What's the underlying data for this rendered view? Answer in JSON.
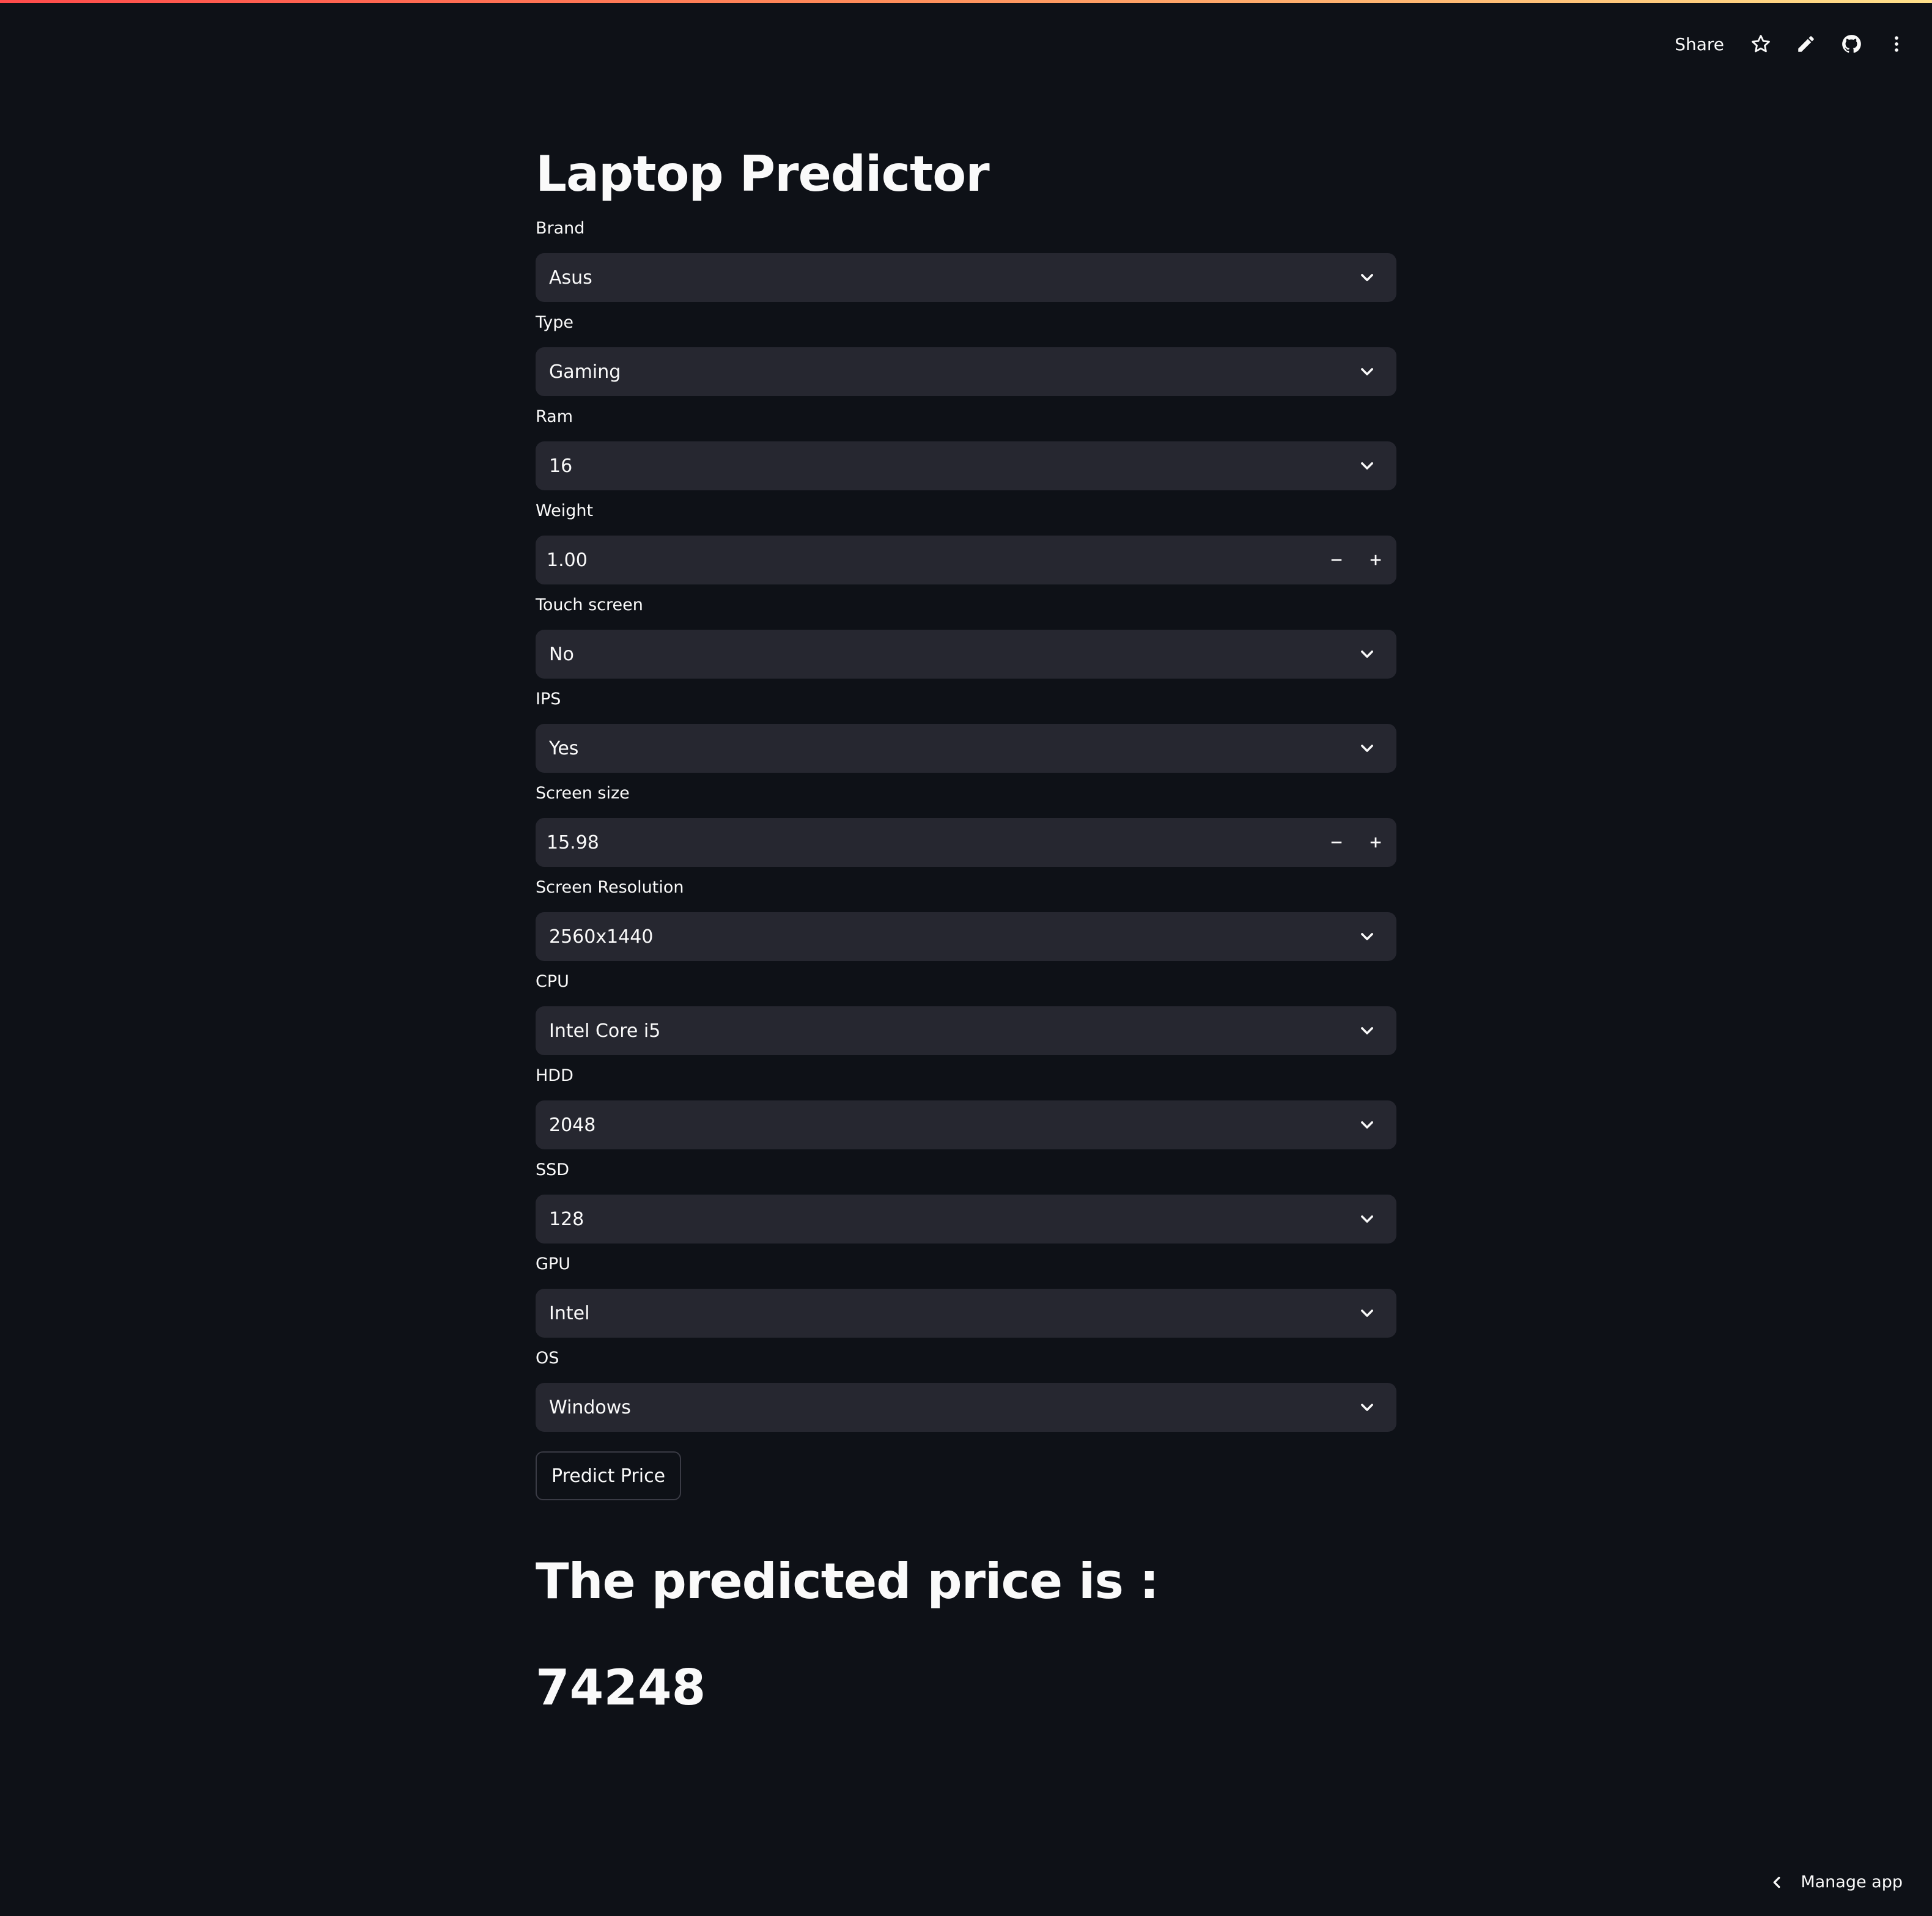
{
  "header": {
    "share_label": "Share",
    "icons": [
      "star-icon",
      "pencil-icon",
      "github-icon",
      "more-vertical-icon"
    ]
  },
  "page": {
    "title": "Laptop Predictor"
  },
  "fields": {
    "brand": {
      "label": "Brand",
      "value": "Asus"
    },
    "type": {
      "label": "Type",
      "value": "Gaming"
    },
    "ram": {
      "label": "Ram",
      "value": "16"
    },
    "weight": {
      "label": "Weight",
      "value": "1.00"
    },
    "touch_screen": {
      "label": "Touch screen",
      "value": "No"
    },
    "ips": {
      "label": "IPS",
      "value": "Yes"
    },
    "screen_size": {
      "label": "Screen size",
      "value": "15.98"
    },
    "screen_resolution": {
      "label": "Screen Resolution",
      "value": "2560x1440"
    },
    "cpu": {
      "label": "CPU",
      "value": "Intel Core i5"
    },
    "hdd": {
      "label": "HDD",
      "value": "2048"
    },
    "ssd": {
      "label": "SSD",
      "value": "128"
    },
    "gpu": {
      "label": "GPU",
      "value": "Intel"
    },
    "os": {
      "label": "OS",
      "value": "Windows"
    }
  },
  "actions": {
    "predict_label": "Predict Price"
  },
  "result": {
    "heading": "The predicted price is :",
    "value": "74248"
  },
  "footer": {
    "manage_label": "Manage app"
  },
  "colors": {
    "background": "#0e1117",
    "input_bg": "#262730",
    "text": "#fafafa",
    "accent_start": "#ff4b4b",
    "accent_end": "#ffe08a"
  }
}
